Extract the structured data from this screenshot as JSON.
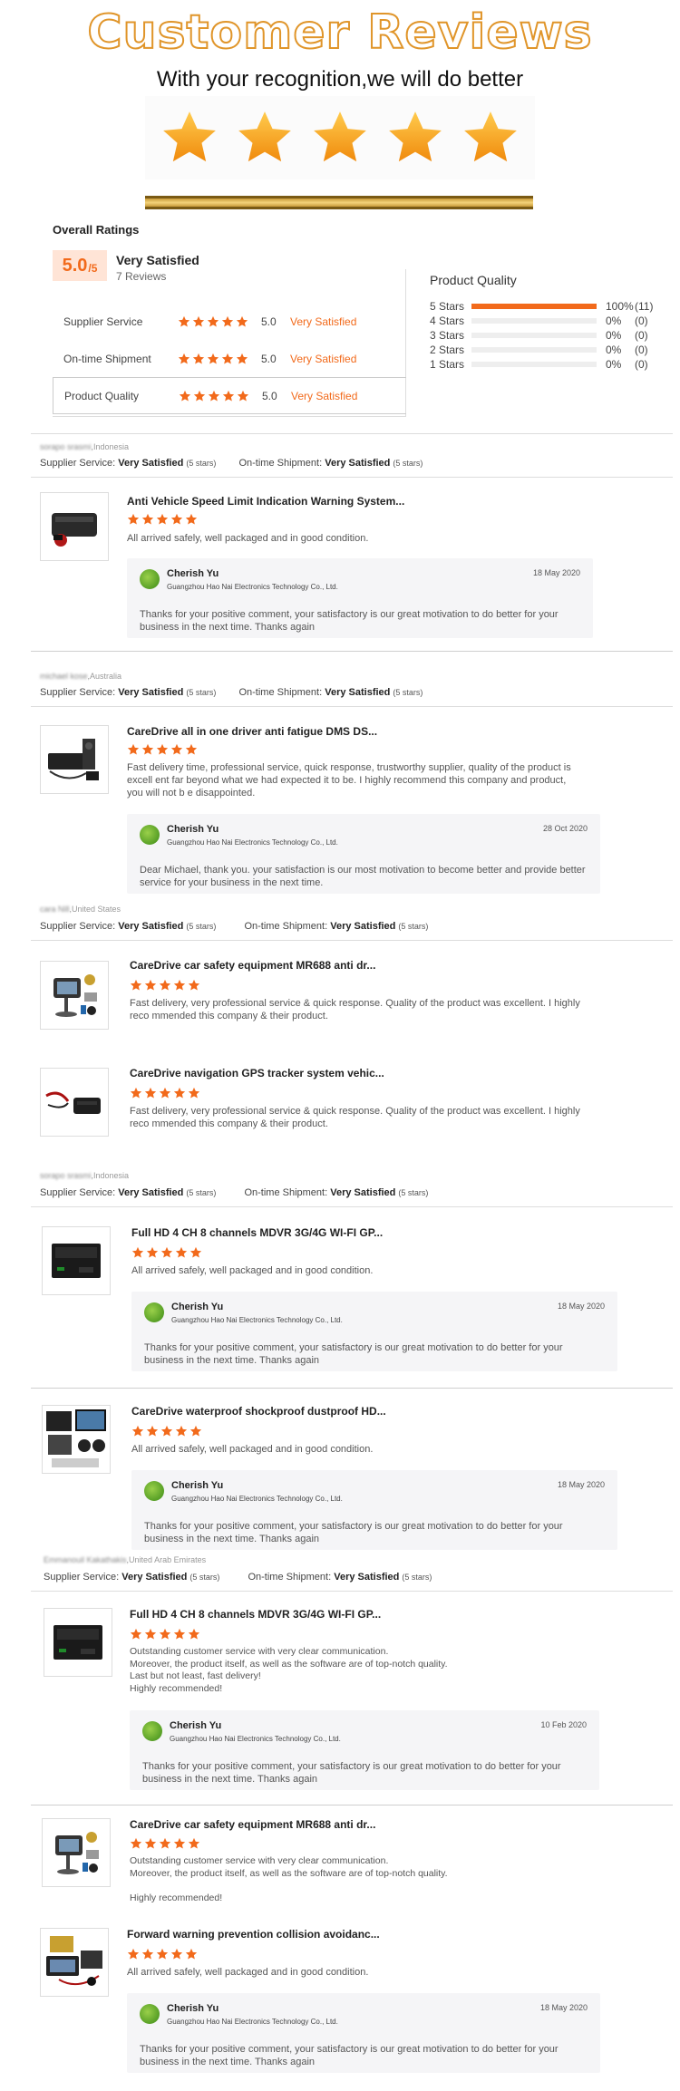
{
  "banner": {
    "title": "Customer Reviews",
    "subtitle": "With your recognition,we will do better",
    "stars": 5
  },
  "colors": {
    "accent": "#f26a1b",
    "gold": "#e0952a"
  },
  "overall": {
    "title": "Overall Ratings",
    "score": "5.0",
    "score_max": "/5",
    "label": "Very Satisfied",
    "count": "7 Reviews",
    "rows": [
      {
        "label": "Supplier Service",
        "score": "5.0",
        "text": "Very Satisfied",
        "stars": 5
      },
      {
        "label": "On-time Shipment",
        "score": "5.0",
        "text": "Very Satisfied",
        "stars": 5
      },
      {
        "label": "Product Quality",
        "score": "5.0",
        "text": "Very Satisfied",
        "stars": 5
      }
    ]
  },
  "quality": {
    "title": "Product Quality",
    "rows": [
      {
        "label": "5 Stars",
        "fraction": 1.0,
        "pct": "100%",
        "count": "(11)"
      },
      {
        "label": "4 Stars",
        "fraction": 0,
        "pct": "0%",
        "count": "(0)"
      },
      {
        "label": "3 Stars",
        "fraction": 0,
        "pct": "0%",
        "count": "(0)"
      },
      {
        "label": "2 Stars",
        "fraction": 0,
        "pct": "0%",
        "count": "(0)"
      },
      {
        "label": "1 Stars",
        "fraction": 0,
        "pct": "0%",
        "count": "(0)"
      }
    ]
  },
  "service_labels": {
    "supplier": "Supplier Service:",
    "shipment": "On-time Shipment:",
    "value": "Very Satisfied",
    "stars": "(5 stars)"
  },
  "reviewers": [
    {
      "name": "sorapo srasmi",
      "country": ",Indonesia"
    },
    {
      "name": "michael kose",
      "country": ",Australia"
    },
    {
      "name": "cara Nill",
      "country": ",United States"
    },
    {
      "name": "sorapo srasmi",
      "country": ",Indonesia"
    },
    {
      "name": "Emmanouil Kakathakis",
      "country": ",United Arab Emirates"
    }
  ],
  "reviews": [
    {
      "title": "Anti Vehicle Speed Limit Indication Warning System...",
      "text": "All arrived safely, well packaged and in good condition.",
      "thumb": "device-black-box"
    },
    {
      "title": "CareDrive all in one driver anti fatigue DMS DS...",
      "text": "Fast delivery time, professional service, quick response, trustworthy supplier, quality of the product is excell ent far beyond what we had expected it to be. I highly recommend this company and product, you will not b e disappointed.",
      "thumb": "dms-kit"
    },
    {
      "title": "CareDrive car safety equipment MR688 anti dr...",
      "text": "Fast delivery, very professional service & quick response. Quality of the product was excellent. I highly reco mmended this company & their product.",
      "thumb": "camera-kit"
    },
    {
      "title": "CareDrive navigation GPS tracker system vehic...",
      "text": "Fast delivery, very professional service & quick response. Quality of the product was excellent. I highly reco mmended this company & their product.",
      "thumb": "gps-tracker"
    },
    {
      "title": "Full HD 4 CH 8 channels MDVR 3G/4G WI-FI GP...",
      "text": "All arrived safely, well packaged and in good condition.",
      "thumb": "mdvr"
    },
    {
      "title": "CareDrive waterproof shockproof dustproof HD...",
      "text": "All arrived safely, well packaged and in good condition.",
      "thumb": "monitor-kit"
    },
    {
      "title": "Full HD 4 CH 8 channels MDVR 3G/4G WI-FI GP...",
      "text": "Outstanding customer service with very clear communication.\nMoreover, the product itself, as well as the software are of top-notch quality.\nLast but not least, fast delivery!\nHighly recommended!",
      "thumb": "mdvr"
    },
    {
      "title": "CareDrive car safety equipment MR688 anti dr...",
      "text": "Outstanding customer service with very clear communication.\nMoreover, the product itself, as well as the software are of top-notch quality.\n\nHighly recommended!",
      "thumb": "camera-kit"
    },
    {
      "title": "Forward warning prevention collision avoidanc...",
      "text": "All arrived safely, well packaged and in good condition.",
      "thumb": "adas-kit"
    }
  ],
  "replies": [
    {
      "name": "Cherish Yu",
      "company": "Guangzhou Hao Nai Electronics Technology Co., Ltd.",
      "date": "18 May 2020",
      "message": "Thanks for your positive comment, your satisfactory is our great motivation to do better for your business in the next time. Thanks again"
    },
    {
      "name": "Cherish Yu",
      "company": "Guangzhou Hao Nai Electronics Technology Co., Ltd.",
      "date": "28 Oct 2020",
      "message": "Dear Michael, thank you. your satisfaction is our most motivation to become better and provide better service for your business in the next time."
    },
    {
      "name": "Cherish Yu",
      "company": "Guangzhou Hao Nai Electronics Technology Co., Ltd.",
      "date": "18 May 2020",
      "message": "Thanks for your positive comment, your satisfactory is our great motivation to do better for your business in the next time. Thanks again"
    },
    {
      "name": "Cherish Yu",
      "company": "Guangzhou Hao Nai Electronics Technology Co., Ltd.",
      "date": "18 May 2020",
      "message": "Thanks for your positive comment, your satisfactory is our great motivation to do better for your business in the next time. Thanks again"
    },
    {
      "name": "Cherish Yu",
      "company": "Guangzhou Hao Nai Electronics Technology Co., Ltd.",
      "date": "10 Feb 2020",
      "message": "Thanks for your positive comment, your satisfactory is our great motivation to do better for your business in the next time. Thanks again"
    },
    {
      "name": "Cherish Yu",
      "company": "Guangzhou Hao Nai Electronics Technology Co., Ltd.",
      "date": "18 May 2020",
      "message": "Thanks for your positive comment, your satisfactory is our great motivation to do better for your business in the next time. Thanks again"
    }
  ]
}
